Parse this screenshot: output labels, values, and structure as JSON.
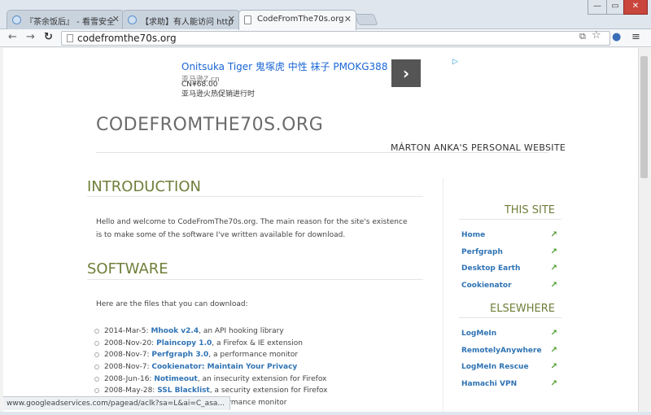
{
  "browser": {
    "tabs": [
      {
        "label": "『茶余饭后』 - 看雪安全"
      },
      {
        "label": "【求助】有人能访问 http"
      },
      {
        "label": "CodeFromThe70s.org"
      }
    ],
    "url": "codefromthe70s.org",
    "window_buttons": {
      "minimize": "—",
      "maximize": "▭",
      "close": "✕"
    }
  },
  "ad": {
    "title": "Onitsuka Tiger 鬼塚虎 中性 袜子 PMOKG388",
    "url": "亚马逊Z.cn",
    "price": "CN¥68.00",
    "line": "亚马逊火热促销进行时",
    "arrow": "›",
    "choice": "▷"
  },
  "site": {
    "title": "CODEFROMTHE70S.ORG",
    "tagline": "MÁRTON ANKA'S PERSONAL WEBSITE"
  },
  "main": {
    "intro_heading": "INTRODUCTION",
    "intro_text": "Hello and welcome to CodeFromThe70s.org. The main reason for the site's existence is to make some of the software I've written available for download.",
    "software_heading": "SOFTWARE",
    "software_intro": "Here are the files that you can download:",
    "downloads": [
      {
        "date": "2014-Mar-5:",
        "name": "Mhook v2.4",
        "desc": ", an API hooking library"
      },
      {
        "date": "2008-Nov-20:",
        "name": "Plaincopy 1.0",
        "desc": ", a Firefox & IE extension"
      },
      {
        "date": "2008-Nov-7:",
        "name": "Perfgraph 3.0",
        "desc": ", a performance monitor"
      },
      {
        "date": "2008-Nov-7:",
        "name": "Cookienator: Maintain Your Privacy",
        "desc": ""
      },
      {
        "date": "2008-Jun-16:",
        "name": "Notimeout",
        "desc": ", an insecurity extension for Firefox"
      },
      {
        "date": "2008-May-28:",
        "name": "SSL Blacklist",
        "desc": ", a security extension for Firefox"
      },
      {
        "date": "",
        "name": "",
        "desc": "rformance monitor"
      }
    ]
  },
  "sidebar": {
    "this_site_heading": "THIS SITE",
    "this_site_links": [
      "Home",
      "Perfgraph",
      "Desktop Earth",
      "Cookienator"
    ],
    "elsewhere_heading": "ELSEWHERE",
    "elsewhere_links": [
      "LogMeIn",
      "RemotelyAnywhere",
      "LogMeIn Rescue",
      "Hamachi VPN"
    ],
    "link_arrow": "↗"
  },
  "status_bar": {
    "text": "www.googleadservices.com/pagead/aclk?sa=L&ai=C_asa..."
  },
  "colors": {
    "accent": "#6f7f3a",
    "link": "#2f73b4",
    "arrow": "#4b9a2c"
  },
  "icons": [
    "back-icon",
    "forward-icon",
    "reload-icon",
    "page-icon",
    "translate-icon",
    "star-icon",
    "extension-icon",
    "menu-icon"
  ]
}
